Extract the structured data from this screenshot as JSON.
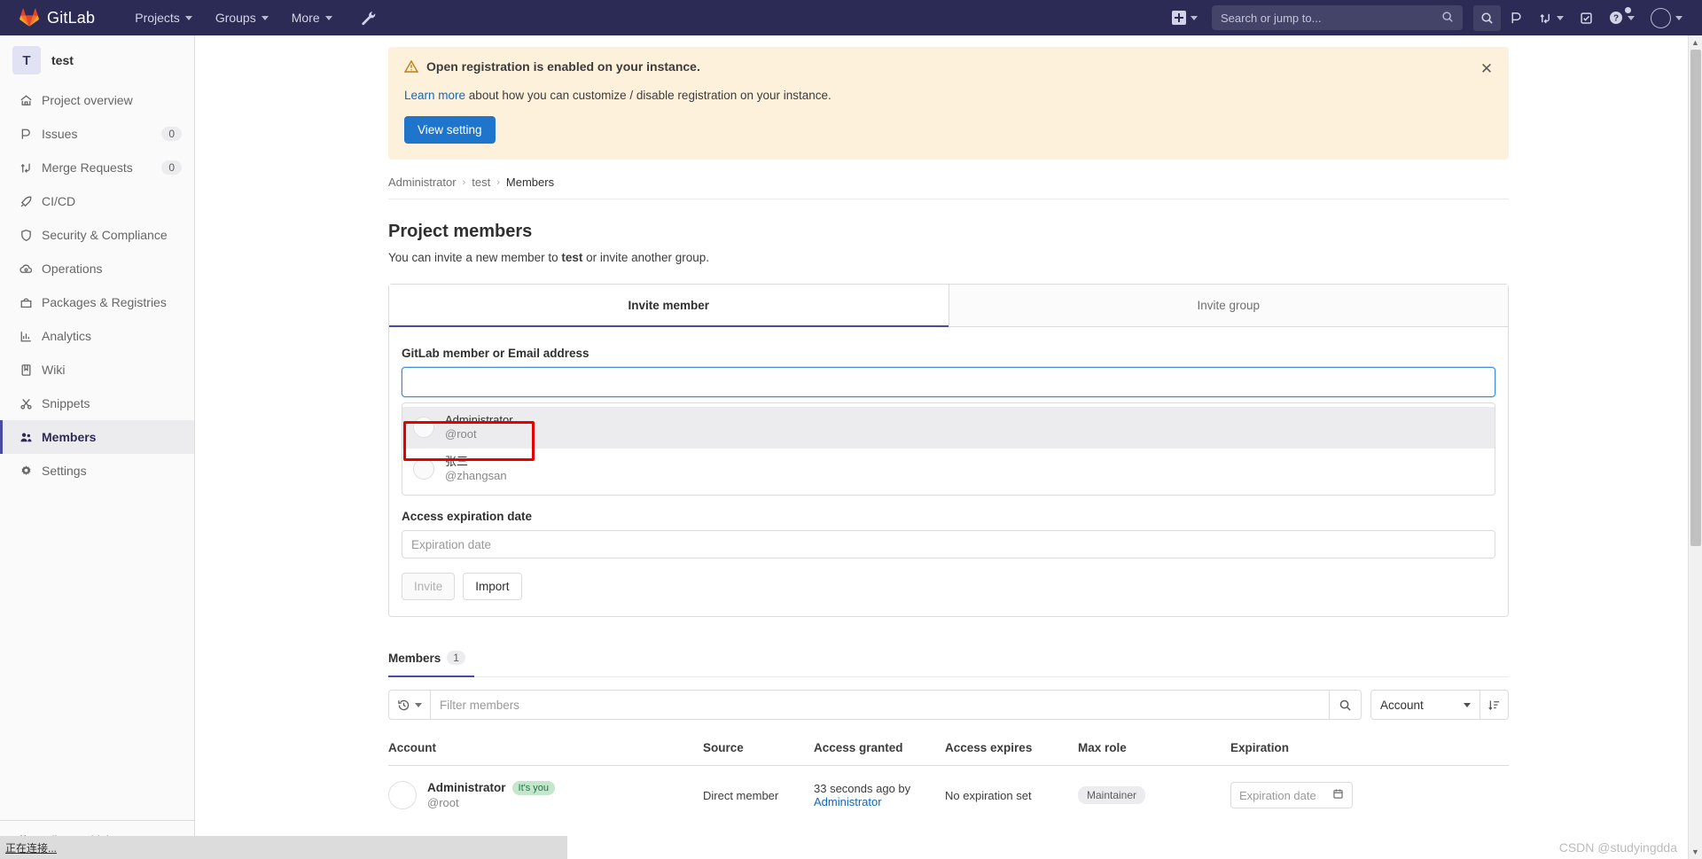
{
  "topnav": {
    "brand": "GitLab",
    "links": [
      {
        "label": "Projects",
        "name": "projects"
      },
      {
        "label": "Groups",
        "name": "groups"
      },
      {
        "label": "More",
        "name": "more"
      }
    ],
    "search_placeholder": "Search or jump to...",
    "icons": {
      "wrench": "wrench-icon",
      "plus": "new-item-icon",
      "search": "search-icon",
      "issues": "issues-icon",
      "merge_requests": "merge-requests-icon",
      "todos": "todos-icon",
      "help": "help-icon",
      "avatar": "user-avatar-icon"
    }
  },
  "sidebar": {
    "project_initial": "T",
    "project_name": "test",
    "items": [
      {
        "label": "Project overview",
        "badge": "",
        "icon": "home-icon",
        "active": false
      },
      {
        "label": "Issues",
        "badge": "0",
        "icon": "issues-icon",
        "active": false
      },
      {
        "label": "Merge Requests",
        "badge": "0",
        "icon": "merge-icon",
        "active": false
      },
      {
        "label": "CI/CD",
        "badge": "",
        "icon": "rocket-icon",
        "active": false
      },
      {
        "label": "Security & Compliance",
        "badge": "",
        "icon": "shield-icon",
        "active": false
      },
      {
        "label": "Operations",
        "badge": "",
        "icon": "cloud-gear-icon",
        "active": false
      },
      {
        "label": "Packages & Registries",
        "badge": "",
        "icon": "package-icon",
        "active": false
      },
      {
        "label": "Analytics",
        "badge": "",
        "icon": "chart-icon",
        "active": false
      },
      {
        "label": "Wiki",
        "badge": "",
        "icon": "book-icon",
        "active": false
      },
      {
        "label": "Snippets",
        "badge": "",
        "icon": "scissors-icon",
        "active": false
      },
      {
        "label": "Members",
        "badge": "",
        "icon": "users-icon",
        "active": true
      },
      {
        "label": "Settings",
        "badge": "",
        "icon": "gear-icon",
        "active": false
      }
    ],
    "collapse_label": "Collapse sidebar"
  },
  "alert": {
    "title": "Open registration is enabled on your instance.",
    "link_text": "Learn more",
    "body_rest": " about how you can customize / disable registration on your instance.",
    "button_label": "View setting",
    "close_label": "✕",
    "bg_color": "#fdf1dc",
    "button_color": "#1f75cb"
  },
  "breadcrumb": {
    "items": [
      "Administrator",
      "test",
      "Members"
    ],
    "separator": "›"
  },
  "page": {
    "title": "Project members",
    "subtitle_before": "You can invite a new member to ",
    "subtitle_bold": "test",
    "subtitle_after": " or invite another group."
  },
  "invite": {
    "tabs": [
      {
        "label": "Invite member",
        "active": true
      },
      {
        "label": "Invite group",
        "active": false
      }
    ],
    "member_field_label": "GitLab member or Email address",
    "member_field_value": "",
    "member_field_placeholder": "",
    "suggestions": [
      {
        "name": "Administrator",
        "handle": "@root",
        "highlighted": true
      },
      {
        "name": "张三",
        "handle": "@zhangsan",
        "highlighted": false
      }
    ],
    "expiration_label": "Access expiration date",
    "expiration_placeholder": "Expiration date",
    "expiration_value": "",
    "buttons": [
      {
        "label": "Invite",
        "disabled": true
      },
      {
        "label": "Import",
        "disabled": false
      }
    ],
    "annotation_color": "#e60000"
  },
  "members_section": {
    "tab_label": "Members",
    "tab_count": "1",
    "filter_placeholder": "Filter members",
    "sort_field": "Account",
    "columns": [
      "Account",
      "Source",
      "Access granted",
      "Access expires",
      "Max role",
      "Expiration"
    ],
    "rows": [
      {
        "account_name": "Administrator",
        "account_badge": "It's you",
        "account_handle": "@root",
        "source": "Direct member",
        "access_granted_text": "33 seconds ago by",
        "access_granted_by": "Administrator",
        "access_expires": "No expiration set",
        "max_role": "Maintainer",
        "expiration_placeholder": "Expiration date"
      }
    ]
  },
  "statusbar": {
    "text": "正在连接..."
  },
  "watermark": {
    "text": "CSDN @studyingdda"
  }
}
